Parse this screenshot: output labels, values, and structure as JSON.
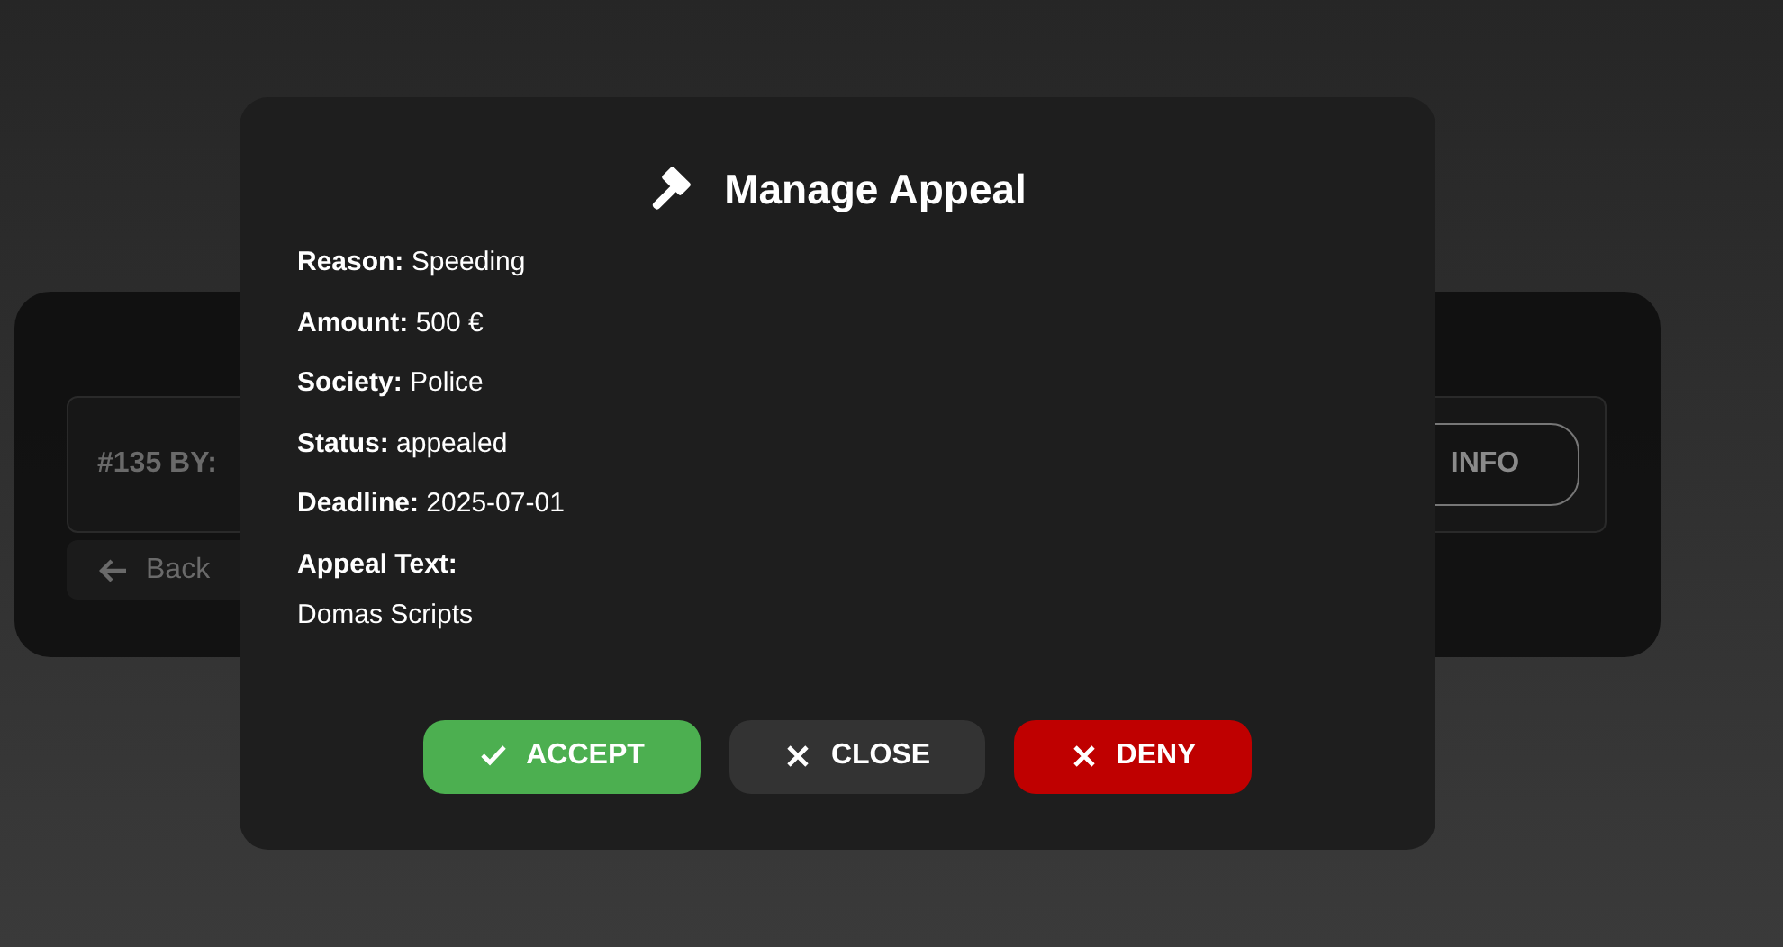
{
  "background": {
    "row": {
      "label": "#135 BY:",
      "button": "INFO"
    },
    "back": "Back"
  },
  "modal": {
    "title": "Manage Appeal",
    "fields": [
      {
        "text": "**Reason:** Speeding"
      },
      {
        "text": "**Amount:** 500 €"
      },
      {
        "text": "**Society:** Police"
      },
      {
        "text": "**Status:** appealed"
      },
      {
        "text": "**Deadline:** 2025-07-01"
      }
    ],
    "appeal_text": {
      "label": "Appeal Text:",
      "value": "Domas Scripts"
    },
    "buttons": [
      {
        "label": "ACCEPT",
        "kind": "accept"
      },
      {
        "label": "CLOSE",
        "kind": "close"
      },
      {
        "label": "DENY",
        "kind": "deny"
      }
    ]
  }
}
